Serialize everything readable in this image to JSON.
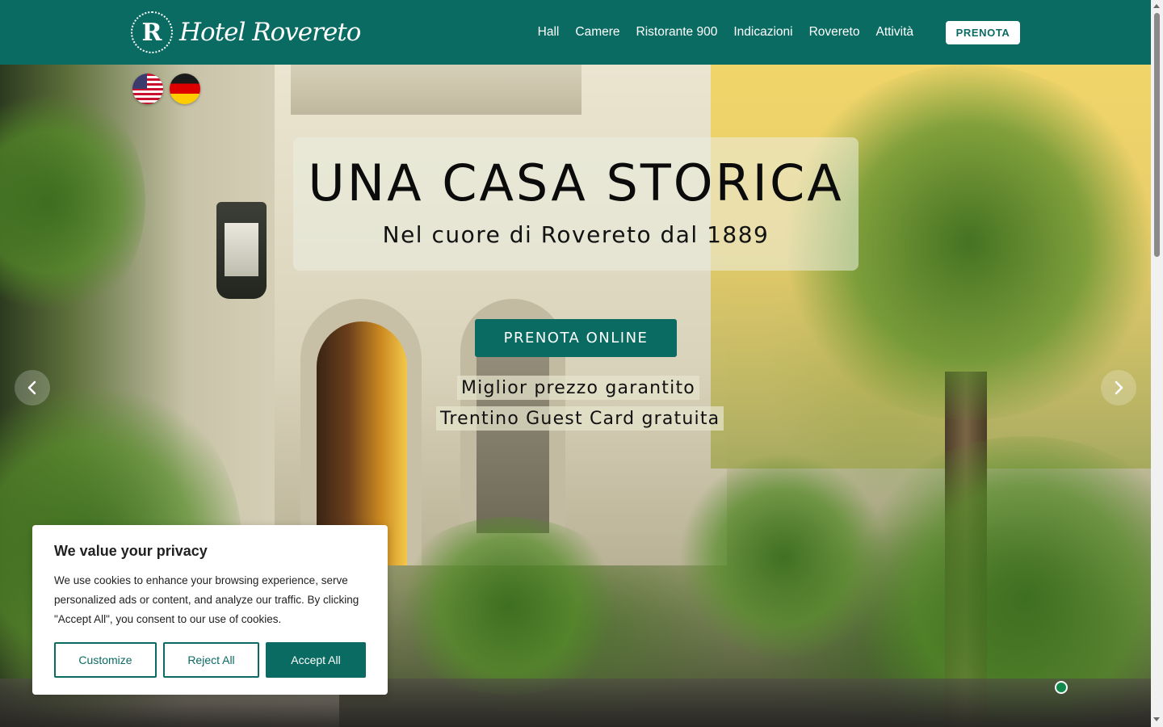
{
  "header": {
    "logo_monogram": "R",
    "logo_text": "Hotel Rovereto",
    "nav": [
      "Hall",
      "Camere",
      "Ristorante 900",
      "Indicazioni",
      "Rovereto",
      "Attività"
    ],
    "cta_label": "PRENOTA"
  },
  "languages": [
    {
      "code": "en",
      "icon": "us-flag-icon"
    },
    {
      "code": "de",
      "icon": "germany-flag-icon"
    }
  ],
  "hero": {
    "headline": "UNA CASA STORICA",
    "subheadline": "Nel cuore di Rovereto dal 1889",
    "cta_label": "PRENOTA ONLINE",
    "perks": [
      "Miglior prezzo garantito",
      "Trentino Guest Card gratuita"
    ],
    "prev_icon": "chevron-left-icon",
    "next_icon": "chevron-right-icon"
  },
  "cookie_banner": {
    "title": "We value your privacy",
    "text": "We use cookies to enhance your browsing experience, serve personalized ads or content, and analyze our traffic. By clicking \"Accept All\", you consent to our use of cookies.",
    "customize_label": "Customize",
    "reject_label": "Reject All",
    "accept_label": "Accept All"
  },
  "colors": {
    "brand": "#0a6b62",
    "slide_indicator": "#0f8a4a"
  }
}
